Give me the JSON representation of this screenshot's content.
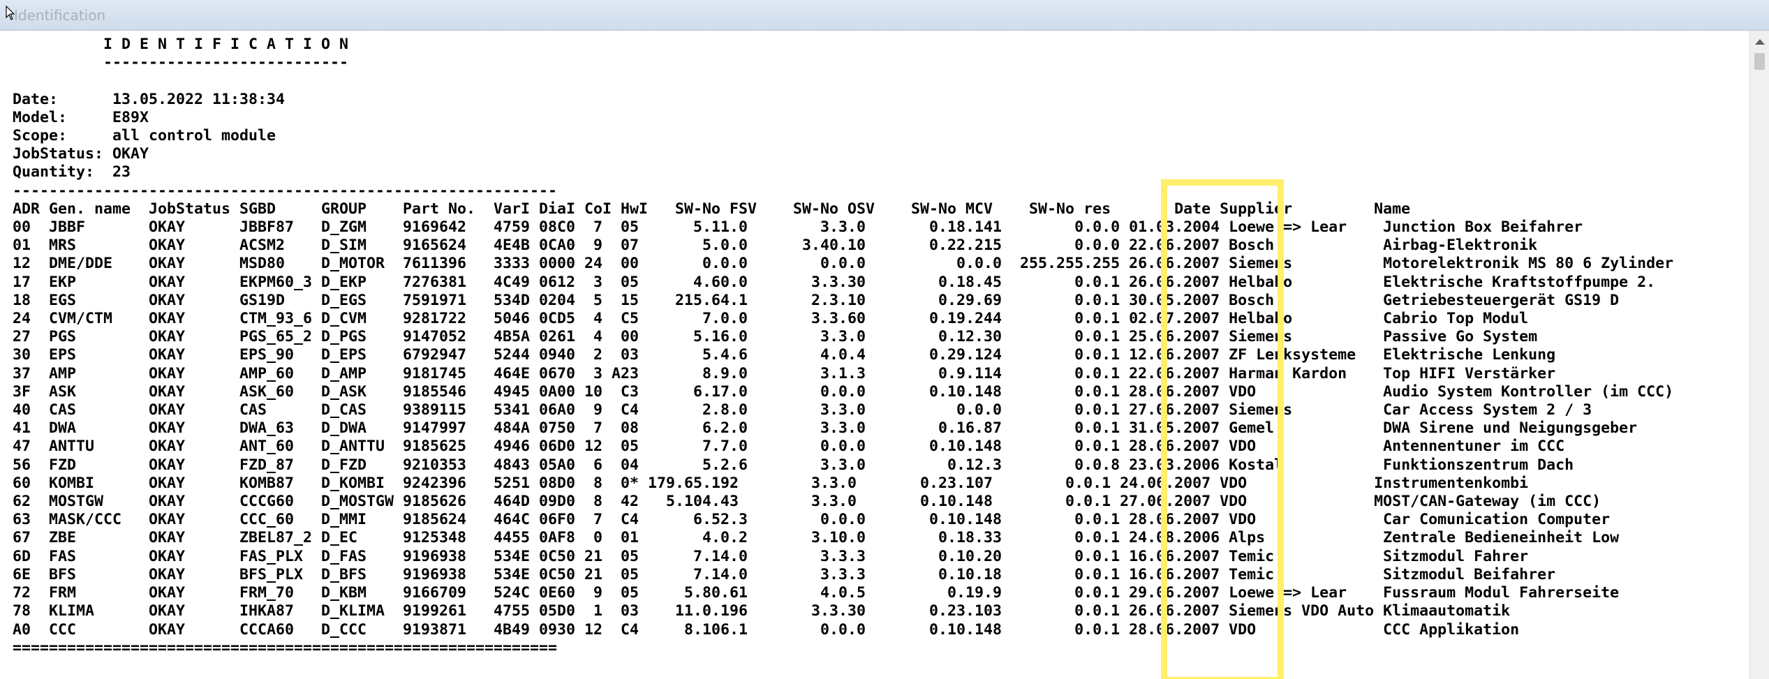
{
  "window": {
    "title": "Identification"
  },
  "report": {
    "lines": [
      "          I D E N T I F I C A T I O N",
      "          ---------------------------",
      "",
      "Date:      13.05.2022 11:38:34",
      "Model:     E89X",
      "Scope:     all control module",
      "JobStatus: OKAY",
      "Quantity:  23",
      "------------------------------------------------------------",
      "ADR Gen. name  JobStatus SGBD     GROUP    Part No.  VarI DiaI CoI HwI   SW-No FSV    SW-No OSV    SW-No MCV    SW-No res       Date Supplier         Name",
      "00  JBBF       OKAY      JBBF87   D_ZGM    9169642   4759 08C0  7  05      5.11.0        3.3.0       0.18.141        0.0.0 01.03.2004 Loewe => Lear    Junction Box Beifahrer",
      "01  MRS        OKAY      ACSM2    D_SIM    9165624   4E4B 0CA0  9  07       5.0.0      3.40.10       0.22.215        0.0.0 22.06.2007 Bosch            Airbag-Elektronik",
      "12  DME/DDE    OKAY      MSD80    D_MOTOR  7611396   3333 0000 24  00       0.0.0        0.0.0          0.0.0  255.255.255 26.06.2007 Siemens          Motorelektronik MS 80 6 Zylinder",
      "17  EKP        OKAY      EKPM60_3 D_EKP    7276381   4C49 0612  3  05      4.60.0       3.3.30        0.18.45        0.0.1 26.06.2007 Helbako          Elektrische Kraftstoffpumpe 2.",
      "18  EGS        OKAY      GS19D    D_EGS    7591971   534D 0204  5  15    215.64.1       2.3.10        0.29.69        0.0.1 30.05.2007 Bosch            Getriebesteuergerät GS19 D",
      "24  CVM/CTM    OKAY      CTM_93_6 D_CVM    9281722   5046 0CD5  4  C5       7.0.0       3.3.60       0.19.244        0.0.1 02.07.2007 Helbako          Cabrio Top Modul",
      "27  PGS        OKAY      PGS_65_2 D_PGS    9147052   4B5A 0261  4  00      5.16.0        3.3.0        0.12.30        0.0.1 25.06.2007 Siemens          Passive Go System",
      "30  EPS        OKAY      EPS_90   D_EPS    6792947   5244 0940  2  03       5.4.6        4.0.4       0.29.124        0.0.1 12.06.2007 ZF Lenksysteme   Elektrische Lenkung",
      "37  AMP        OKAY      AMP_60   D_AMP    9181745   464E 0670  3 A23       8.9.0        3.1.3        0.9.114        0.0.1 22.06.2007 Harman Kardon    Top HIFI Verstärker",
      "3F  ASK        OKAY      ASK_60   D_ASK    9185546   4945 0A00 10  C3      6.17.0        0.0.0       0.10.148        0.0.1 28.06.2007 VDO              Audio System Kontroller (im CCC)",
      "40  CAS        OKAY      CAS      D_CAS    9389115   5341 06A0  9  C4       2.8.0        3.3.0          0.0.0        0.0.1 27.06.2007 Siemens          Car Access System 2 / 3",
      "41  DWA        OKAY      DWA_63   D_DWA    9147997   484A 0750  7  08       6.2.0        3.3.0        0.16.87        0.0.1 31.05.2007 Gemel            DWA Sirene und Neigungsgeber",
      "47  ANTTU      OKAY      ANT_60   D_ANTTU  9185625   4946 06D0 12  05       7.7.0        0.0.0       0.10.148        0.0.1 28.06.2007 VDO              Antennentuner im CCC",
      "56  FZD        OKAY      FZD_87   D_FZD    9210353   4843 05A0  6  04       5.2.6        3.3.0         0.12.3        0.0.8 23.03.2006 Kostal           Funktionszentrum Dach",
      "60  KOMBI      OKAY      KOMB87   D_KOMBI  9242396   5251 08D0  8  0* 179.65.192        3.3.0       0.23.107        0.0.1 24.06.2007 VDO              Instrumentenkombi",
      "62  MOSTGW     OKAY      CCCG60   D_MOSTGW 9185626   464D 09D0  8  42   5.104.43        3.3.0       0.10.148        0.0.1 27.06.2007 VDO              MOST/CAN-Gateway (im CCC)",
      "63  MASK/CCC   OKAY      CCC_60   D_MMI    9185624   464C 06F0  7  C4      6.52.3        0.0.0       0.10.148        0.0.1 28.06.2007 VDO              Car Comunication Computer",
      "67  ZBE        OKAY      ZBEL87_2 D_EC     9125348   4455 0AF8  0  01       4.0.2       3.10.0        0.18.33        0.0.1 24.08.2006 Alps             Zentrale Bedieneinheit Low",
      "6D  FAS        OKAY      FAS_PLX  D_FAS    9196938   534E 0C50 21  05      7.14.0        3.3.3        0.10.20        0.0.1 16.06.2007 Temic            Sitzmodul Fahrer",
      "6E  BFS        OKAY      BFS_PLX  D_BFS    9196938   534E 0C50 21  05      7.14.0        3.3.3        0.10.18        0.0.1 16.06.2007 Temic            Sitzmodul Beifahrer",
      "72  FRM        OKAY      FRM_70   D_KBM    9166709   524C 0E60  9  05     5.80.61        4.0.5         0.19.9        0.0.1 29.06.2007 Loewe => Lear    Fussraum Modul Fahrerseite",
      "78  KLIMA      OKAY      IHKA87   D_KLIMA  9199261   4755 05D0  1  03    11.0.196       3.3.30       0.23.103        0.0.1 26.06.2007 Siemens VDO Auto Klimaautomatik",
      "A0  CCC        OKAY      CCCA60   D_CCC    9193871   4B49 0930 12  C4     8.106.1        0.0.0       0.10.148        0.0.1 28.06.2007 VDO              CCC Applikation",
      "============================================================"
    ]
  },
  "colors": {
    "highlight": "#ffef6a",
    "titlebar": "#d6e2ef"
  }
}
